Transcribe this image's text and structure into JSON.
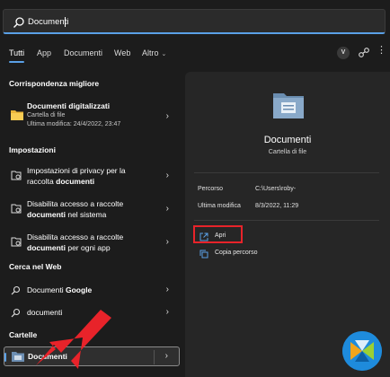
{
  "search": {
    "value": "Documenti"
  },
  "tabs": [
    {
      "label": "Tutti"
    },
    {
      "label": "App"
    },
    {
      "label": "Documenti"
    },
    {
      "label": "Web"
    },
    {
      "label": "Altro"
    }
  ],
  "account": {
    "initial": "V"
  },
  "sections": {
    "best_match": "Corrispondenza migliore",
    "settings": "Impostazioni",
    "web": "Cerca nel Web",
    "folders": "Cartelle"
  },
  "best_match": {
    "title": "Documenti digitalizzati",
    "sub1": "Cartella di file",
    "sub2": "Ultima modifica: 24/4/2022, 23:47"
  },
  "settings_items": [
    {
      "line1": "Impostazioni di privacy per la",
      "line2_plain": "raccolta ",
      "line2_bold": "documenti",
      "line2_tail": ""
    },
    {
      "line1": "Disabilita accesso a raccolte",
      "line2_plain": "",
      "line2_bold": "documenti",
      "line2_tail": " nel sistema"
    },
    {
      "line1": "Disabilita accesso a raccolte",
      "line2_plain": "",
      "line2_bold": "documenti",
      "line2_tail": " per ogni app"
    }
  ],
  "web_items": [
    {
      "plain": "Documenti ",
      "bold": "Google"
    },
    {
      "plain": "documenti",
      "bold": ""
    }
  ],
  "folder_item": {
    "label": "Documenti"
  },
  "detail": {
    "title": "Documenti",
    "subtitle": "Cartella di file",
    "path_label": "Percorso",
    "path_value": "C:\\Users\\roby-",
    "modified_label": "Ultima modifica",
    "modified_value": "8/3/2022, 11:29",
    "actions": [
      {
        "label": "Apri",
        "icon": "open-external-icon"
      },
      {
        "label": "Copia percorso",
        "icon": "copy-icon"
      }
    ]
  },
  "colors": {
    "accent": "#5aa0e6",
    "highlight": "#e8232a",
    "arrow": "#e8232a",
    "background": "#1c1c1c",
    "panel": "#262626"
  }
}
